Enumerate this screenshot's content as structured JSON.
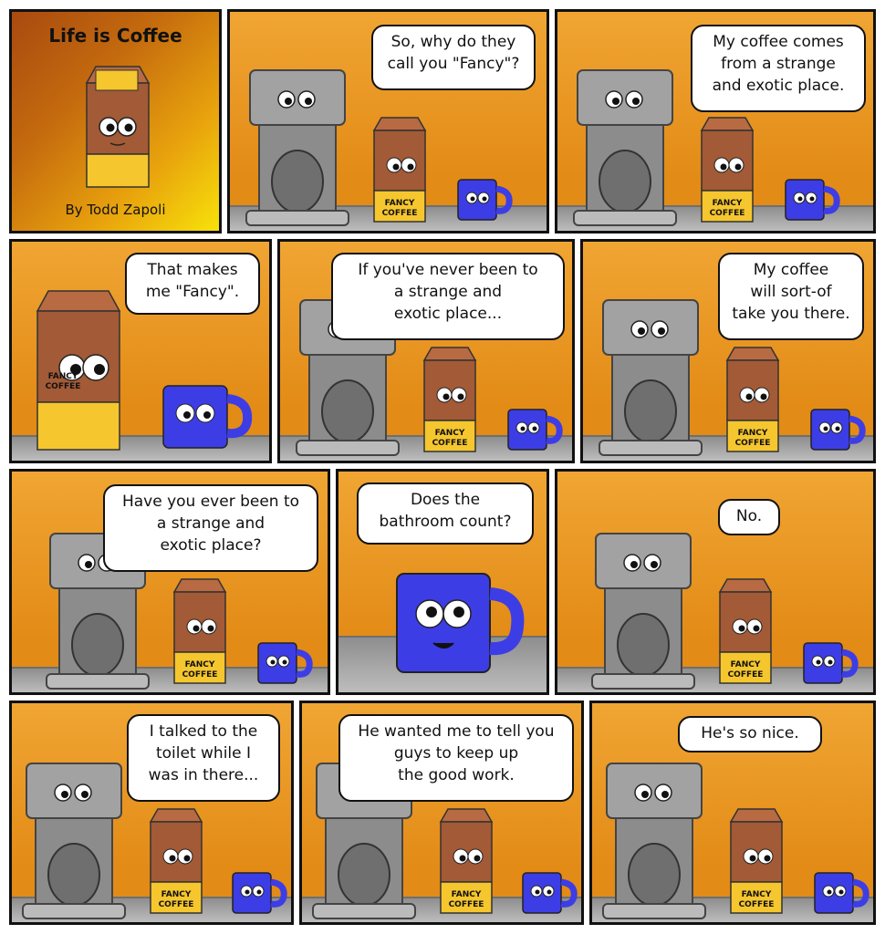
{
  "comic": {
    "title": "Life is Coffee",
    "byline": "By Todd Zapoli",
    "product_label_line1": "FANCY",
    "product_label_line2": "COFFEE"
  },
  "panels": [
    {
      "id": 1,
      "dialogue": "So,  why do they\ncall you \"Fancy\"?"
    },
    {
      "id": 2,
      "dialogue": "My coffee comes\nfrom a strange\nand exotic place."
    },
    {
      "id": 3,
      "dialogue": "That makes\nme \"Fancy\"."
    },
    {
      "id": 4,
      "dialogue": "If you've never been to\na strange and\nexotic place..."
    },
    {
      "id": 5,
      "dialogue": "My coffee\nwill sort-of\ntake you there."
    },
    {
      "id": 6,
      "dialogue": "Have you ever been to\na strange and\nexotic place?"
    },
    {
      "id": 7,
      "dialogue": "Does the\nbathroom count?"
    },
    {
      "id": 8,
      "dialogue": "No."
    },
    {
      "id": 9,
      "dialogue": "I talked to the\ntoilet while I\nwas in there..."
    },
    {
      "id": 10,
      "dialogue": "He wanted me to tell you\nguys to keep up\nthe good work."
    },
    {
      "id": 11,
      "dialogue": "He's so nice."
    }
  ],
  "colors": {
    "background_orange": "#e8951f",
    "counter_gray": "#a3a3a3",
    "mug_blue": "#3d3de6",
    "bag_brown": "#9e5a38",
    "bag_yellow": "#f5c62e",
    "machine_silver": "#9a9a9a"
  }
}
